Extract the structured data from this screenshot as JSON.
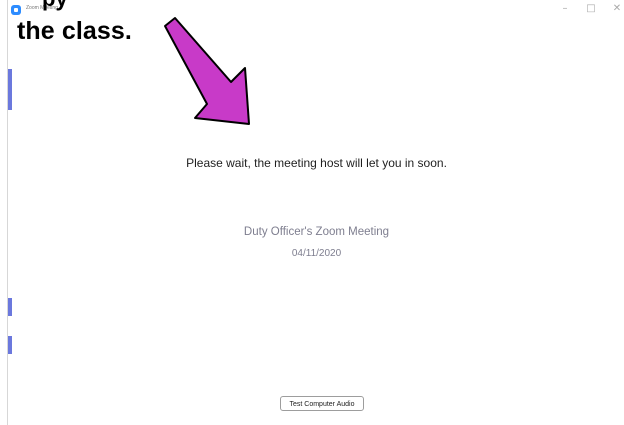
{
  "window": {
    "title": "Zoom Meeting",
    "minimize_glyph": "–",
    "maximize_glyph": "□",
    "close_glyph": "✕",
    "app_icon": "zoom-app-icon"
  },
  "overlay": {
    "top_cut_text": "py",
    "caption": "the class.",
    "arrow_color": "#c83ac8",
    "arrow_icon": "pointer-arrow-icon"
  },
  "main": {
    "wait_message": "Please wait, the meeting host will let you in soon.",
    "meeting_name": "Duty Officer's Zoom Meeting",
    "meeting_date": "04/11/2020"
  },
  "footer": {
    "test_audio_label": "Test Computer Audio"
  },
  "colors": {
    "brand_blue": "#2d8cff",
    "meeting_text": "#7e7e8f",
    "arrow_magenta": "#c83ac8"
  }
}
